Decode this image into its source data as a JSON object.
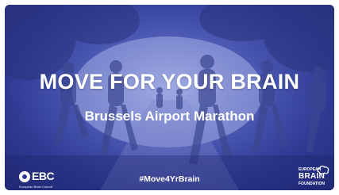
{
  "video": {
    "title": "MOVE FOR YOUR BRAIN",
    "subtitle": "Brussels Airport Marathon",
    "hashtag": "#Move4YrBrain"
  },
  "logos": {
    "ebc_name": "EBC",
    "ebc_sub": "European Brain Council",
    "ebf_line1": "EUROPEAN",
    "ebf_line2": "BRAIN",
    "ebf_line3": "FOUNDATION"
  },
  "colors": {
    "overlay": "#2e3a92",
    "text": "#ffffff"
  }
}
